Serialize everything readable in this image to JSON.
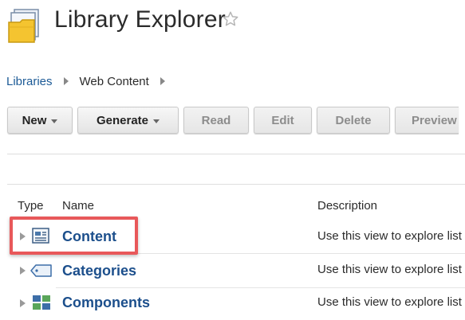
{
  "header": {
    "title": "Library Explorer",
    "app_icon": "folder-library-icon",
    "favorite_icon": "star-outline-icon"
  },
  "breadcrumb": {
    "items": [
      {
        "label": "Libraries",
        "link": true
      },
      {
        "label": "Web Content",
        "link": false
      }
    ]
  },
  "toolbar": {
    "buttons": [
      {
        "label": "New",
        "dropdown": true,
        "enabled": true
      },
      {
        "label": "Generate",
        "dropdown": true,
        "enabled": true
      },
      {
        "label": "Read",
        "dropdown": false,
        "enabled": false
      },
      {
        "label": "Edit",
        "dropdown": false,
        "enabled": false
      },
      {
        "label": "Delete",
        "dropdown": false,
        "enabled": false
      },
      {
        "label": "Preview",
        "dropdown": false,
        "enabled": false
      }
    ]
  },
  "table": {
    "columns": [
      "Type",
      "Name",
      "Description"
    ],
    "rows": [
      {
        "name": "Content",
        "description": "Use this view to explore list",
        "icon": "content-view-icon",
        "highlighted": true
      },
      {
        "name": "Categories",
        "description": "Use this view to explore list",
        "icon": "tag-icon",
        "highlighted": false
      },
      {
        "name": "Components",
        "description": "Use this view to explore list",
        "icon": "component-grid-icon",
        "highlighted": false
      }
    ]
  },
  "colors": {
    "link": "#1c5a96",
    "row_name": "#1c4f8c",
    "highlight_border": "#e8585a",
    "folder_yellow": "#f4c430"
  }
}
